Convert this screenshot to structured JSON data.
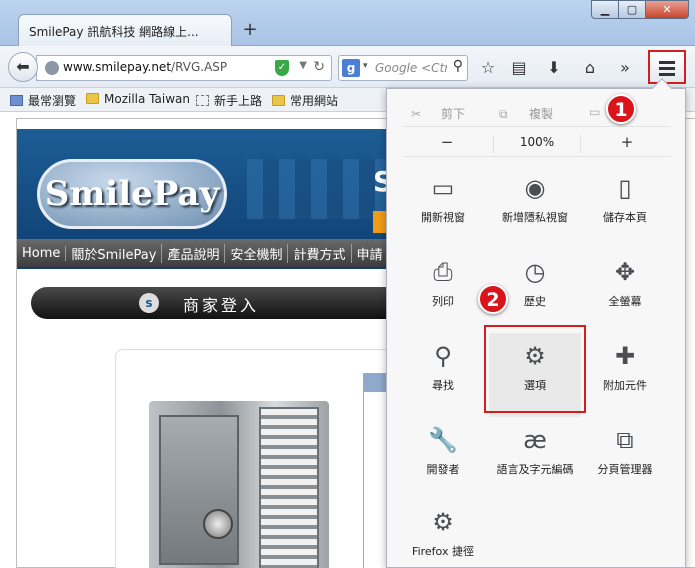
{
  "browser": {
    "tab_title": "SmilePay 訊航科技 網路線上...",
    "new_tab": "+",
    "window_buttons": {
      "minimize": "▁",
      "maximize": "▢",
      "close": "✕"
    },
    "url_host": "www.smilepay.net",
    "url_path": "/RVG.ASP",
    "search_placeholder": "Google <Ctrl+K>",
    "search_engine": "g",
    "bookmarks": [
      {
        "label": "最常瀏覽",
        "icon": "most-visited-icon"
      },
      {
        "label": "Mozilla Taiwan",
        "icon": "folder-icon"
      },
      {
        "label": "新手上路",
        "icon": "dashed-folder-icon"
      },
      {
        "label": "常用網站",
        "icon": "folder-icon"
      }
    ],
    "toolbar_icons": [
      "star-icon",
      "reading-list-icon",
      "download-icon",
      "home-icon",
      "overflow-icon"
    ]
  },
  "site": {
    "logo_text": "SmilePay",
    "banner_letter": "S",
    "nav": [
      "Home",
      "關於SmilePay",
      "產品說明",
      "安全機制",
      "計費方式",
      "申請"
    ],
    "login_title": "商家登入",
    "login_icon_letter": "s"
  },
  "menu": {
    "cut": "剪下",
    "copy": "複製",
    "zoom_out": "−",
    "zoom_level": "100%",
    "zoom_in": "+",
    "items": [
      {
        "label": "開新視窗",
        "icon": "new-window-icon"
      },
      {
        "label": "新增隱私視窗",
        "icon": "private-window-icon"
      },
      {
        "label": "儲存本頁",
        "icon": "save-page-icon"
      },
      {
        "label": "列印",
        "icon": "print-icon"
      },
      {
        "label": "歷史",
        "icon": "history-icon"
      },
      {
        "label": "全螢幕",
        "icon": "fullscreen-icon"
      },
      {
        "label": "尋找",
        "icon": "find-icon"
      },
      {
        "label": "選項",
        "icon": "options-gear-icon"
      },
      {
        "label": "附加元件",
        "icon": "addons-icon"
      },
      {
        "label": "開發者",
        "icon": "developer-icon"
      },
      {
        "label": "語言及字元編碼",
        "icon": "character-encoding-icon"
      },
      {
        "label": "分頁管理器",
        "icon": "tab-groups-icon"
      },
      {
        "label": "Firefox 捷徑",
        "icon": "firefox-shortcut-icon"
      }
    ]
  },
  "annotations": {
    "step1": "1",
    "step2": "2"
  },
  "colors": {
    "highlight_red": "#d21e1e",
    "badge_red": "#d9151b"
  }
}
